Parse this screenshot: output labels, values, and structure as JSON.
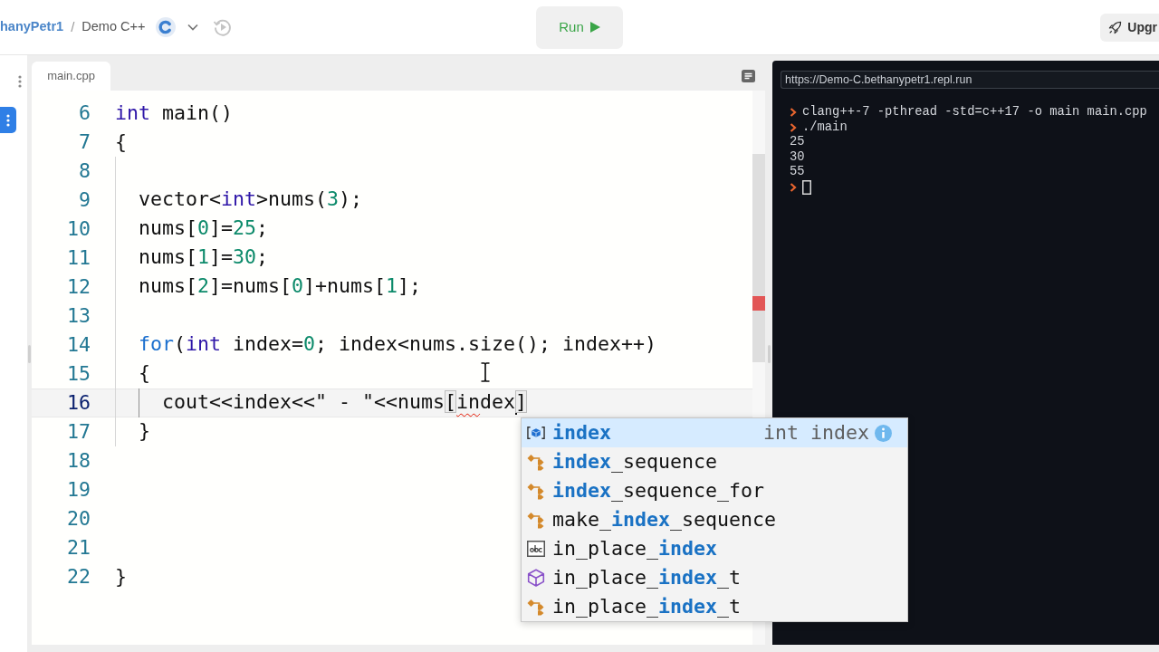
{
  "topbar": {
    "owner": "hanyPetr1",
    "separator": "/",
    "repl_name": "Demo C++",
    "run_button": "Run",
    "upgrade_button": "Upgr"
  },
  "editor": {
    "tab": {
      "label": "main.cpp",
      "selected": true
    },
    "lines": [
      {
        "number": "6",
        "current": false,
        "tokens": [
          {
            "kind": "type",
            "text": "int"
          },
          {
            "kind": "plain",
            "text": " main()"
          }
        ]
      },
      {
        "number": "7",
        "current": false,
        "tokens": [
          {
            "kind": "plain",
            "text": "{"
          }
        ]
      },
      {
        "number": "8",
        "current": false
      },
      {
        "number": "9",
        "current": false,
        "tokens": [
          {
            "kind": "plain",
            "text": "  vector<"
          },
          {
            "kind": "type",
            "text": "int"
          },
          {
            "kind": "plain",
            "text": ">nums("
          },
          {
            "kind": "number",
            "text": "3"
          },
          {
            "kind": "plain",
            "text": ");"
          }
        ]
      },
      {
        "number": "10",
        "current": false,
        "tokens": [
          {
            "kind": "plain",
            "text": "  nums["
          },
          {
            "kind": "number",
            "text": "0"
          },
          {
            "kind": "plain",
            "text": "]="
          },
          {
            "kind": "number",
            "text": "25"
          },
          {
            "kind": "plain",
            "text": ";"
          }
        ]
      },
      {
        "number": "11",
        "current": false,
        "tokens": [
          {
            "kind": "plain",
            "text": "  nums["
          },
          {
            "kind": "number",
            "text": "1"
          },
          {
            "kind": "plain",
            "text": "]="
          },
          {
            "kind": "number",
            "text": "30"
          },
          {
            "kind": "plain",
            "text": ";"
          }
        ]
      },
      {
        "number": "12",
        "current": false,
        "tokens": [
          {
            "kind": "plain",
            "text": "  nums["
          },
          {
            "kind": "number",
            "text": "2"
          },
          {
            "kind": "plain",
            "text": "]=nums["
          },
          {
            "kind": "number",
            "text": "0"
          },
          {
            "kind": "plain",
            "text": "]+nums["
          },
          {
            "kind": "number",
            "text": "1"
          },
          {
            "kind": "plain",
            "text": "];"
          }
        ]
      },
      {
        "number": "13",
        "current": false
      },
      {
        "number": "14",
        "current": false,
        "tokens": [
          {
            "kind": "control",
            "text": "  for"
          },
          {
            "kind": "plain",
            "text": "("
          },
          {
            "kind": "type",
            "text": "int"
          },
          {
            "kind": "plain",
            "text": " index="
          },
          {
            "kind": "number",
            "text": "0"
          },
          {
            "kind": "plain",
            "text": "; index<nums.size(); index++)"
          }
        ]
      },
      {
        "number": "15",
        "current": false,
        "tokens": [
          {
            "kind": "plain",
            "text": "  {"
          }
        ]
      },
      {
        "number": "16",
        "current": true,
        "tokens": [
          {
            "kind": "plain",
            "text": "    cout<<index<<\" - \"<<nums"
          },
          {
            "kind": "bracket",
            "text": "["
          },
          {
            "kind": "error",
            "text": "in"
          },
          {
            "kind": "plain",
            "text": "dex",
            "caret": true
          },
          {
            "kind": "bracket",
            "text": "]"
          }
        ]
      },
      {
        "number": "17",
        "current": false,
        "tokens": [
          {
            "kind": "plain",
            "text": "  }"
          }
        ]
      },
      {
        "number": "18",
        "current": false
      },
      {
        "number": "19",
        "current": false
      },
      {
        "number": "20",
        "current": false
      },
      {
        "number": "21",
        "current": false
      },
      {
        "number": "22",
        "current": false,
        "tokens": [
          {
            "kind": "plain",
            "text": "}"
          }
        ]
      }
    ]
  },
  "autocomplete": {
    "items": [
      {
        "kind": "variable",
        "label": "**index**",
        "detail": "int index",
        "selected": true
      },
      {
        "kind": "class",
        "label": "**index**_sequence",
        "selected": false
      },
      {
        "kind": "class",
        "label": "**index**_sequence_for",
        "selected": false
      },
      {
        "kind": "class",
        "label": "make_**index**_sequence",
        "selected": false
      },
      {
        "kind": "text",
        "label": "in_place_**index**",
        "selected": false
      },
      {
        "kind": "method",
        "label": "in_place_**index**_t",
        "selected": false
      },
      {
        "kind": "class",
        "label": "in_place_**index**_t",
        "selected": false
      }
    ]
  },
  "console": {
    "url": "https://Demo-C.bethanypetr1.repl.run",
    "lines": [
      {
        "kind": "command",
        "text": "clang++-7 -pthread -std=c++17 -o main main.cpp"
      },
      {
        "kind": "command",
        "text": "./main"
      },
      {
        "kind": "output",
        "text": "25"
      },
      {
        "kind": "output",
        "text": "30"
      },
      {
        "kind": "output",
        "text": "55"
      },
      {
        "kind": "input"
      }
    ]
  }
}
